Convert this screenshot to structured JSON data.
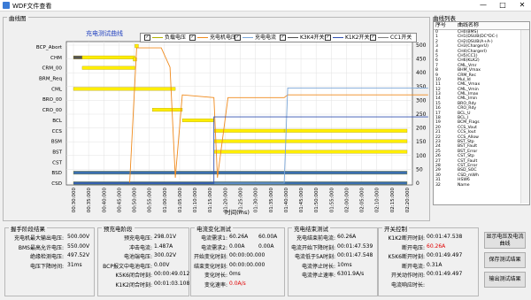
{
  "window": {
    "title": "WDF文件查看"
  },
  "chart_group": {
    "title": "曲线图"
  },
  "list_group": {
    "title": "曲线列表"
  },
  "chart_data": {
    "type": "line",
    "title": "充电测试曲线",
    "xlabel": "时间(ms)",
    "x_ticks": [
      "00:30:000",
      "00:35:000",
      "00:40:000",
      "00:45:000",
      "00:50:000",
      "00:55:000",
      "01:00:000",
      "01:05:000",
      "01:10:000",
      "01:15:000",
      "01:20:000",
      "01:25:000",
      "01:30:000",
      "01:35:000",
      "01:40:000",
      "01:45:000",
      "01:50:000",
      "01:55:000",
      "02:00:000",
      "02:05:000",
      "02:10:000",
      "02:15:000",
      "02:20:000"
    ],
    "y_left_labels": [
      "BCP_Abort",
      "CHM",
      "CRM_00",
      "BRM_Req",
      "CML",
      "BRO_00",
      "CRO_00",
      "BCL",
      "CCS",
      "BSM",
      "BST",
      "CST",
      "BSD",
      "CSD"
    ],
    "y_right": [
      0,
      50,
      100,
      150,
      200,
      250,
      300,
      350,
      400,
      450,
      500
    ],
    "legend": [
      {
        "label": "负载电压",
        "color": "#b0b000"
      },
      {
        "label": "充电机电压",
        "color": "#f08a1c"
      },
      {
        "label": "充电电流",
        "color": "#7aa6d8"
      },
      {
        "label": "K3K4开关",
        "color": "#505050"
      },
      {
        "label": "K1K2开关",
        "color": "#3050b0"
      },
      {
        "label": "CC1开关",
        "color": "#808080"
      }
    ],
    "series": [
      {
        "name": "充电机电压",
        "color": "#f08a1c",
        "points": [
          [
            0.3,
            0
          ],
          [
            0.62,
            0
          ],
          [
            0.66,
            490
          ],
          [
            0.8,
            490
          ],
          [
            0.85,
            420
          ],
          [
            0.88,
            20
          ],
          [
            0.92,
            320
          ],
          [
            1.1,
            310
          ],
          [
            1.12,
            20
          ],
          [
            1.18,
            310
          ],
          [
            1.5,
            310
          ],
          [
            1.52,
            320
          ],
          [
            2.32,
            320
          ]
        ]
      },
      {
        "name": "充电电流",
        "color": "#7aa6d8",
        "points": [
          [
            0.3,
            0
          ],
          [
            1.5,
            0
          ],
          [
            1.52,
            345
          ],
          [
            2.32,
            345
          ]
        ]
      },
      {
        "name": "K1K2开关",
        "color": "#3050b0",
        "points": [
          [
            0.3,
            0
          ],
          [
            1.1,
            0
          ],
          [
            1.1,
            240
          ],
          [
            2.32,
            240
          ]
        ]
      }
    ]
  },
  "curve_list": {
    "header": {
      "no": "序号",
      "name": "曲线名称"
    },
    "items": [
      {
        "no": "0",
        "name": "CH0(BMS)"
      },
      {
        "no": "1",
        "name": "CH1(DSUB(DC*DC-)"
      },
      {
        "no": "2",
        "name": "CH2(DSUB(A+A-)"
      },
      {
        "no": "3",
        "name": "CH3(ChargerU)"
      },
      {
        "no": "4",
        "name": "CH4(ChargerI)"
      },
      {
        "no": "5",
        "name": "CH5(CC1)"
      },
      {
        "no": "6",
        "name": "CH6(KLK2)"
      },
      {
        "no": "7",
        "name": "CML_Vmr"
      },
      {
        "no": "8",
        "name": "BHM_Vmax"
      },
      {
        "no": "9",
        "name": "CRM_Rec"
      },
      {
        "no": "10",
        "name": "Mul_Id"
      },
      {
        "no": "11",
        "name": "CML_Vmax"
      },
      {
        "no": "12",
        "name": "CML_Vmin"
      },
      {
        "no": "13",
        "name": "CML_Imax"
      },
      {
        "no": "14",
        "name": "CML_Imin"
      },
      {
        "no": "15",
        "name": "BRO_Rdy"
      },
      {
        "no": "16",
        "name": "CRO_Rdy"
      },
      {
        "no": "17",
        "name": "BCL_U"
      },
      {
        "no": "18",
        "name": "BCL_I"
      },
      {
        "no": "19",
        "name": "BCM_Flags"
      },
      {
        "no": "20",
        "name": "CCS_Vout"
      },
      {
        "no": "21",
        "name": "CCS_Iout"
      },
      {
        "no": "22",
        "name": "CCS_Allow"
      },
      {
        "no": "23",
        "name": "BST_Stp"
      },
      {
        "no": "24",
        "name": "BST_Fault"
      },
      {
        "no": "25",
        "name": "BST_Error"
      },
      {
        "no": "26",
        "name": "CST_Stp"
      },
      {
        "no": "27",
        "name": "CST_Fault"
      },
      {
        "no": "28",
        "name": "CST_Error"
      },
      {
        "no": "29",
        "name": "BSD_SOC"
      },
      {
        "no": "30",
        "name": "CSD_mWh"
      },
      {
        "no": "31",
        "name": "HSW6"
      },
      {
        "no": "32",
        "name": "Name"
      }
    ]
  },
  "handshake": {
    "title": "握手阶段结果",
    "rows": [
      {
        "k": "充电机最大输出电压:",
        "v": "500.00V"
      },
      {
        "k": "BMS最高允许电压:",
        "v": "550.00V"
      },
      {
        "k": "绝缘检测电压:",
        "v": "497.52V"
      },
      {
        "k": "电压下降时间:",
        "v": "31ms"
      }
    ]
  },
  "precharge": {
    "title": "预充电阶段",
    "rows": [
      {
        "k": "预充电电压:",
        "v": "298.01V"
      },
      {
        "k": "冲击电流:",
        "v": "1.487A"
      },
      {
        "k": "电池端电压:",
        "v": "300.02V"
      },
      {
        "k": "BCP报文中电池电压:",
        "v": "0.00V"
      },
      {
        "k": "K5K6闭合时刻:",
        "v": "00:00:49.012"
      },
      {
        "k": "K1K2闭合时刻:",
        "v": "00:01:03.108"
      }
    ]
  },
  "current_change": {
    "title": "电流变化测试",
    "rows": [
      {
        "k": "电流需求1:",
        "v": "60.26A",
        "v2": "60.00A"
      },
      {
        "k": "电流需求2:",
        "v": "0.00A",
        "v2": "0.00A"
      },
      {
        "k": "开始变化时刻:",
        "v": "00:00:00.000",
        "v2": ""
      },
      {
        "k": "结束变化时刻:",
        "v": "00:00:00.000",
        "v2": ""
      },
      {
        "k": "变化时长:",
        "v": "0ms",
        "v2": ""
      },
      {
        "k": "变化速率:",
        "v": "0.0A/s",
        "v2": ""
      }
    ]
  },
  "end_test": {
    "title": "充电结束测试",
    "rows": [
      {
        "k": "充电结束前电流:",
        "v": "60.26A"
      },
      {
        "k": "电流开始下降时刻:",
        "v": "00:01:47.539"
      },
      {
        "k": "电流低于5A时刻:",
        "v": "00:01:47.548"
      },
      {
        "k": "电流停止时长:",
        "v": "10ms"
      },
      {
        "k": "电流停止速率:",
        "v": "6301.9A/s"
      }
    ]
  },
  "switch_control": {
    "title": "开关控制",
    "rows": [
      {
        "k": "K1K2断开时刻:",
        "v": "00:01:47.538"
      },
      {
        "k": "断开电压:",
        "v": "60.26A"
      },
      {
        "k": "K5K6断开时刻:",
        "v": "00:01:49.497"
      },
      {
        "k": "断开电流:",
        "v": "0.31A"
      },
      {
        "k": "开关动作时间:",
        "v": "00:01:49.497"
      },
      {
        "k": "电流响应时长:",
        "v": ""
      }
    ]
  },
  "buttons": {
    "show_curves": "显示电压及电流曲线",
    "save_results": "保存测试结果",
    "export_results": "输出测试结果"
  }
}
